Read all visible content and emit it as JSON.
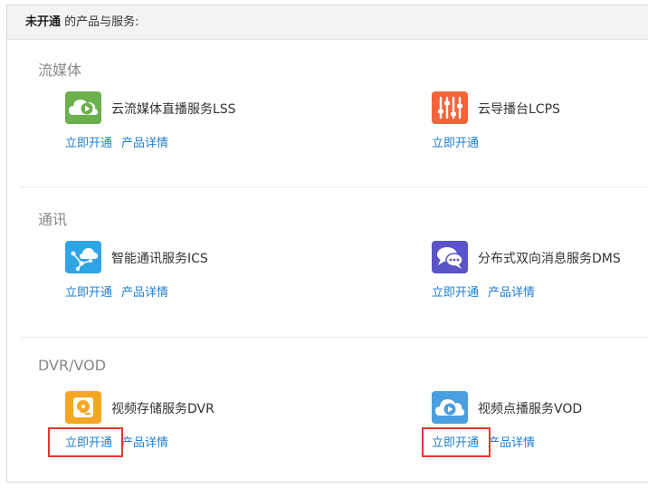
{
  "header": {
    "strong_text": "未开通",
    "rest_text": " 的产品与服务:"
  },
  "sections": [
    {
      "title": "流媒体",
      "products": [
        {
          "name": "云流媒体直播服务LSS",
          "icon": "cloud-play-icon",
          "color": "#6ab04c",
          "activate_label": "立即开通",
          "details_label": "产品详情"
        },
        {
          "name": "云导播台LCPS",
          "icon": "equalizer-icon",
          "color": "#f4643a",
          "activate_label": "立即开通"
        }
      ]
    },
    {
      "title": "通讯",
      "products": [
        {
          "name": "智能通讯服务ICS",
          "icon": "network-cloud-icon",
          "color": "#2fa4e7",
          "activate_label": "立即开通",
          "details_label": "产品详情"
        },
        {
          "name": "分布式双向消息服务DMS",
          "icon": "chat-bubbles-icon",
          "color": "#5a54c8",
          "activate_label": "立即开通",
          "details_label": "产品详情"
        }
      ]
    },
    {
      "title": "DVR/VOD",
      "products": [
        {
          "name": "视频存储服务DVR",
          "icon": "storage-drive-icon",
          "color": "#f5a623",
          "activate_label": "立即开通",
          "details_label": "产品详情"
        },
        {
          "name": "视频点播服务VOD",
          "icon": "cloud-play-icon",
          "color": "#4a9fe0",
          "activate_label": "立即开通",
          "details_label": "产品详情"
        }
      ]
    }
  ],
  "colors": {
    "link": "#1f7fd0",
    "highlight": "#e03a2f"
  }
}
